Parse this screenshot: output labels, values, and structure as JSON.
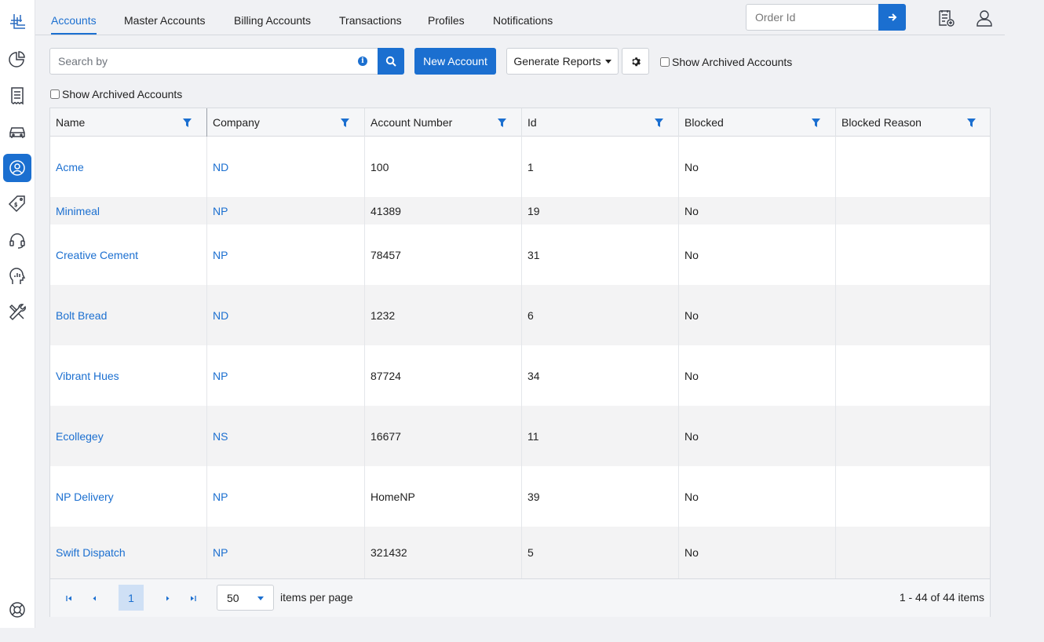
{
  "sidebar": {
    "items": [
      {
        "icon": "logo-icon"
      },
      {
        "icon": "dashboard-pie-icon"
      },
      {
        "icon": "receipt-icon"
      },
      {
        "icon": "car-icon"
      },
      {
        "icon": "user-circle-icon",
        "active": true
      },
      {
        "icon": "price-tag-icon"
      },
      {
        "icon": "headset-icon"
      },
      {
        "icon": "analytics-head-icon"
      },
      {
        "icon": "tools-icon"
      },
      {
        "icon": "help-lifebuoy-icon"
      }
    ]
  },
  "header": {
    "tabs": [
      {
        "label": "Accounts",
        "active": true
      },
      {
        "label": "Master Accounts"
      },
      {
        "label": "Billing Accounts"
      },
      {
        "label": "Transactions"
      },
      {
        "label": "Profiles"
      },
      {
        "label": "Notifications"
      }
    ],
    "order_placeholder": "Order Id"
  },
  "toolbar": {
    "search_placeholder": "Search by",
    "new_account_label": "New Account",
    "generate_reports_label": "Generate Reports",
    "show_archived_label": "Show Archived Accounts",
    "show_archived_label_2": "Show Archived Accounts"
  },
  "grid": {
    "columns": [
      "Name",
      "Company",
      "Account Number",
      "Id",
      "Blocked",
      "Blocked Reason"
    ],
    "rows": [
      {
        "name": "Acme",
        "company": "ND",
        "account_number": "100",
        "id": "1",
        "blocked": "No",
        "blocked_reason": ""
      },
      {
        "name": "Minimeal",
        "company": "NP",
        "account_number": "41389",
        "id": "19",
        "blocked": "No",
        "blocked_reason": ""
      },
      {
        "name": "Creative Cement",
        "company": "NP",
        "account_number": "78457",
        "id": "31",
        "blocked": "No",
        "blocked_reason": ""
      },
      {
        "name": "Bolt Bread",
        "company": "ND",
        "account_number": "1232",
        "id": "6",
        "blocked": "No",
        "blocked_reason": ""
      },
      {
        "name": "Vibrant Hues",
        "company": "NP",
        "account_number": "87724",
        "id": "34",
        "blocked": "No",
        "blocked_reason": ""
      },
      {
        "name": "Ecollegey",
        "company": "NS",
        "account_number": "16677",
        "id": "11",
        "blocked": "No",
        "blocked_reason": ""
      },
      {
        "name": "NP Delivery",
        "company": "NP",
        "account_number": "HomeNP",
        "id": "39",
        "blocked": "No",
        "blocked_reason": ""
      },
      {
        "name": "Swift Dispatch",
        "company": "NP",
        "account_number": "321432",
        "id": "5",
        "blocked": "No",
        "blocked_reason": ""
      }
    ]
  },
  "pager": {
    "current_page": "1",
    "page_size": "50",
    "items_per_page_label": "items per page",
    "info": "1 - 44 of 44 items"
  },
  "colors": {
    "accent": "#1b6fd0",
    "background": "#f0f1f4"
  }
}
